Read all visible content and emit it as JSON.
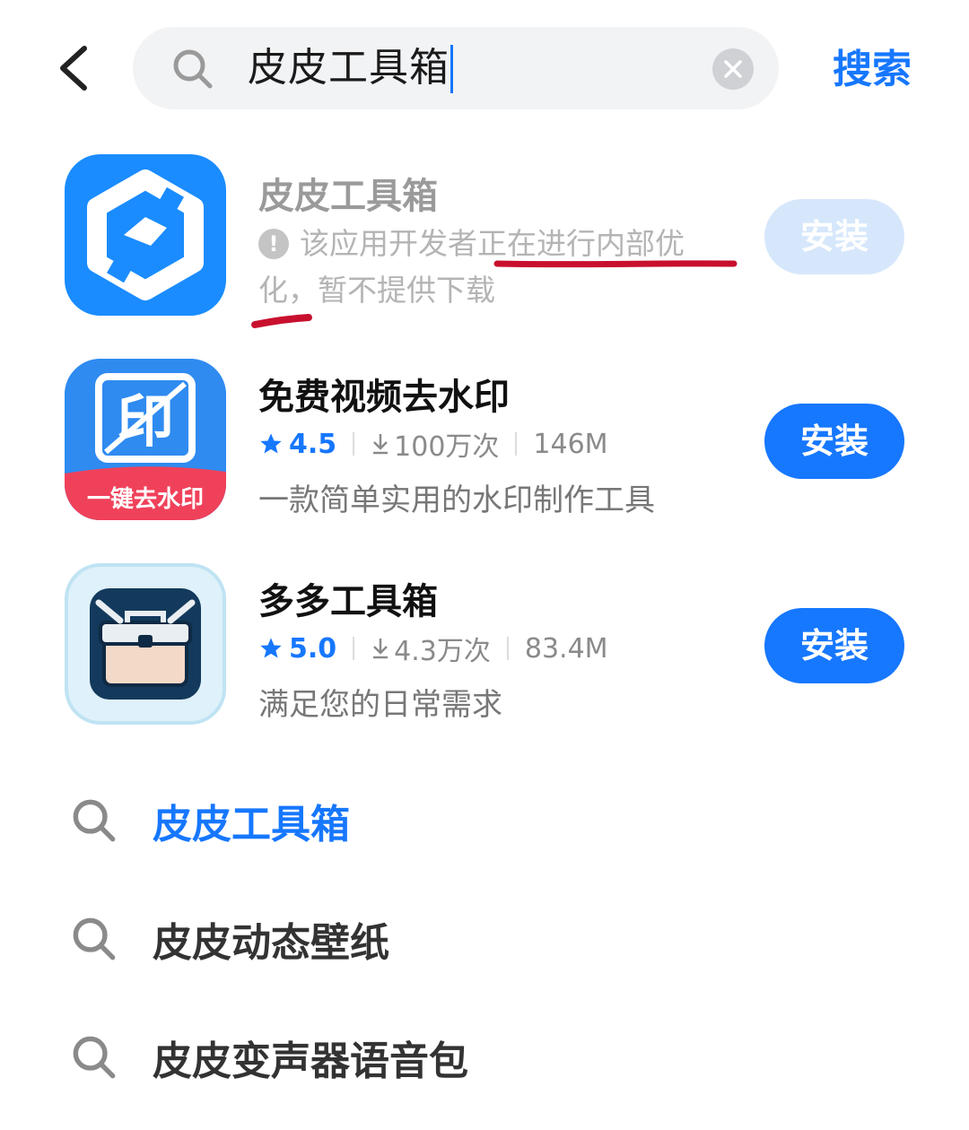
{
  "header": {
    "back_icon": "chevron-left-icon",
    "search_value": "皮皮工具箱",
    "clear_icon": "clear-x-icon",
    "search_button": "搜索"
  },
  "apps": [
    {
      "name": "皮皮工具箱",
      "notice": "该应用开发者正在进行内部优化，暂不提供下载",
      "install_label": "安装",
      "install_enabled": false,
      "icon": "wrench-hexagon-icon"
    },
    {
      "name": "免费视频去水印",
      "rating": "4.5",
      "downloads": "100万次",
      "size": "146M",
      "description": "一款简单实用的水印制作工具",
      "install_label": "安装",
      "icon": "watermark-stamp-icon",
      "icon_banner": "一键去水印"
    },
    {
      "name": "多多工具箱",
      "rating": "5.0",
      "downloads": "4.3万次",
      "size": "83.4M",
      "description": "满足您的日常需求",
      "install_label": "安装",
      "icon": "toolbox-icon"
    }
  ],
  "suggestions": [
    {
      "text": "皮皮工具箱",
      "highlighted": true
    },
    {
      "text": "皮皮动态壁纸",
      "highlighted": false
    },
    {
      "text": "皮皮变声器语音包",
      "highlighted": false
    }
  ],
  "colors": {
    "accent": "#1677ff",
    "annotation_red": "#c8102e",
    "disabled_button": "#d6e7fb"
  }
}
